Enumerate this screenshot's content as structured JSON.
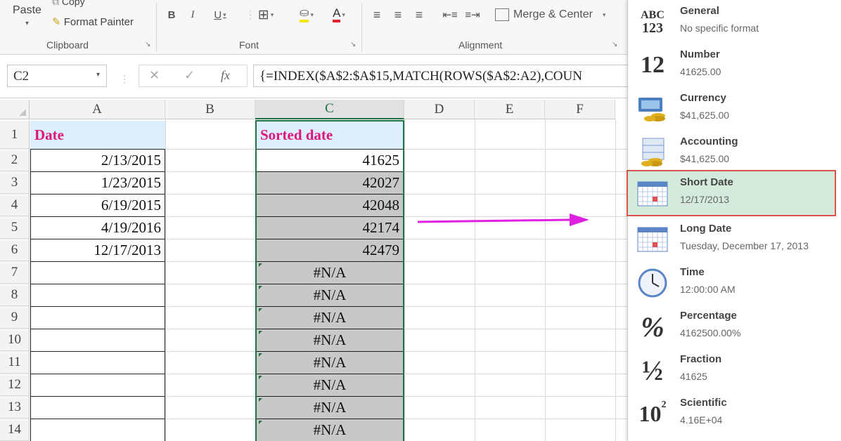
{
  "ribbon": {
    "clipboard": {
      "paste": "Paste",
      "copy": "Copy",
      "format_painter": "Format Painter",
      "group_label": "Clipboard"
    },
    "font": {
      "bold": "B",
      "italic": "I",
      "underline": "U",
      "font_color_glyph": "A",
      "group_label": "Font"
    },
    "alignment": {
      "merge_center": "Merge & Center",
      "group_label": "Alignment"
    }
  },
  "formula_bar": {
    "name_box": "C2",
    "fx": "fx",
    "cancel": "✕",
    "enter": "✓",
    "formula": "{=INDEX($A$2:$A$15,MATCH(ROWS($A$2:A2),COUN"
  },
  "grid": {
    "columns": [
      "A",
      "B",
      "C",
      "D",
      "E",
      "F"
    ],
    "rows": [
      "1",
      "2",
      "3",
      "4",
      "5",
      "6",
      "7",
      "8",
      "9",
      "10",
      "11",
      "12",
      "13",
      "14"
    ],
    "col_a_header": "Date",
    "col_c_header": "Sorted date",
    "col_a_values": [
      "2/13/2015",
      "1/23/2015",
      "6/19/2015",
      "4/19/2016",
      "12/17/2013",
      "",
      "",
      "",
      "",
      "",
      "",
      "",
      ""
    ],
    "col_c_values": [
      "41625",
      "42027",
      "42048",
      "42174",
      "42479",
      "#N/A",
      "#N/A",
      "#N/A",
      "#N/A",
      "#N/A",
      "#N/A",
      "#N/A",
      "#N/A"
    ]
  },
  "format_menu": {
    "items": [
      {
        "name": "General",
        "sample": "No specific format",
        "icon": "general-abc123-icon",
        "glyph_top": "ABC",
        "glyph_bottom": "123"
      },
      {
        "name": "Number",
        "sample": "41625.00",
        "icon": "number-12-icon",
        "glyph": "12"
      },
      {
        "name": "Currency",
        "sample": "$41,625.00",
        "icon": "currency-icon"
      },
      {
        "name": "Accounting",
        "sample": "$41,625.00",
        "icon": "accounting-icon"
      },
      {
        "name": "Short Date",
        "sample": "12/17/2013",
        "icon": "calendar-icon"
      },
      {
        "name": "Long Date",
        "sample": "Tuesday, December 17, 2013",
        "icon": "calendar-icon"
      },
      {
        "name": "Time",
        "sample": "12:00:00 AM",
        "icon": "clock-icon"
      },
      {
        "name": "Percentage",
        "sample": "4162500.00%",
        "icon": "percent-icon",
        "glyph": "%"
      },
      {
        "name": "Fraction",
        "sample": "41625",
        "icon": "fraction-icon",
        "glyph": "½"
      },
      {
        "name": "Scientific",
        "sample": "4.16E+04",
        "icon": "scientific-icon",
        "glyph": "10",
        "glyph_sup": "2"
      }
    ],
    "selected": "Short Date"
  },
  "colors": {
    "header_text": "#e0157c",
    "header_fill": "#ddeefc",
    "shade_fill": "#c8c8c8",
    "selection_green": "#217346",
    "highlight_fill": "#d3eadc",
    "highlight_border": "#d9534f",
    "arrow": "#e020e0"
  }
}
